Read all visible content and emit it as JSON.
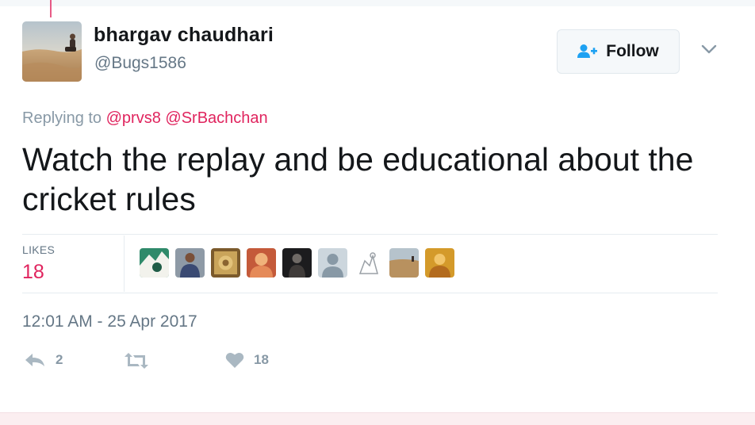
{
  "tweet": {
    "author": {
      "fullname": "bhargav chaudhari",
      "username": "@Bugs1586",
      "avatar_icon": "desert-avatar"
    },
    "follow_button": {
      "label": "Follow",
      "icon": "add-user-icon"
    },
    "menu_icon": "chevron-down-icon",
    "replying": {
      "prefix": "Replying to",
      "mentions": [
        "@prvs8",
        "@SrBachchan"
      ]
    },
    "text": "Watch the replay and be educational about the cricket rules",
    "stats": {
      "likes_label": "LIKES",
      "likes_count": "18",
      "liker_avatars": [
        "liker-avatar-1",
        "liker-avatar-2",
        "liker-avatar-3",
        "liker-avatar-4",
        "liker-avatar-5",
        "liker-avatar-6",
        "liker-avatar-7",
        "liker-avatar-8",
        "liker-avatar-9"
      ]
    },
    "timestamp": "12:01 AM - 25 Apr 2017",
    "actions": {
      "reply": {
        "icon": "reply-icon",
        "count": "2"
      },
      "retweet": {
        "icon": "retweet-icon",
        "count": ""
      },
      "like": {
        "icon": "heart-icon",
        "count": "18"
      }
    }
  },
  "colors": {
    "accent": "#e0245e",
    "muted": "#657786",
    "link_blue": "#1da1f2",
    "text": "#14171a"
  }
}
